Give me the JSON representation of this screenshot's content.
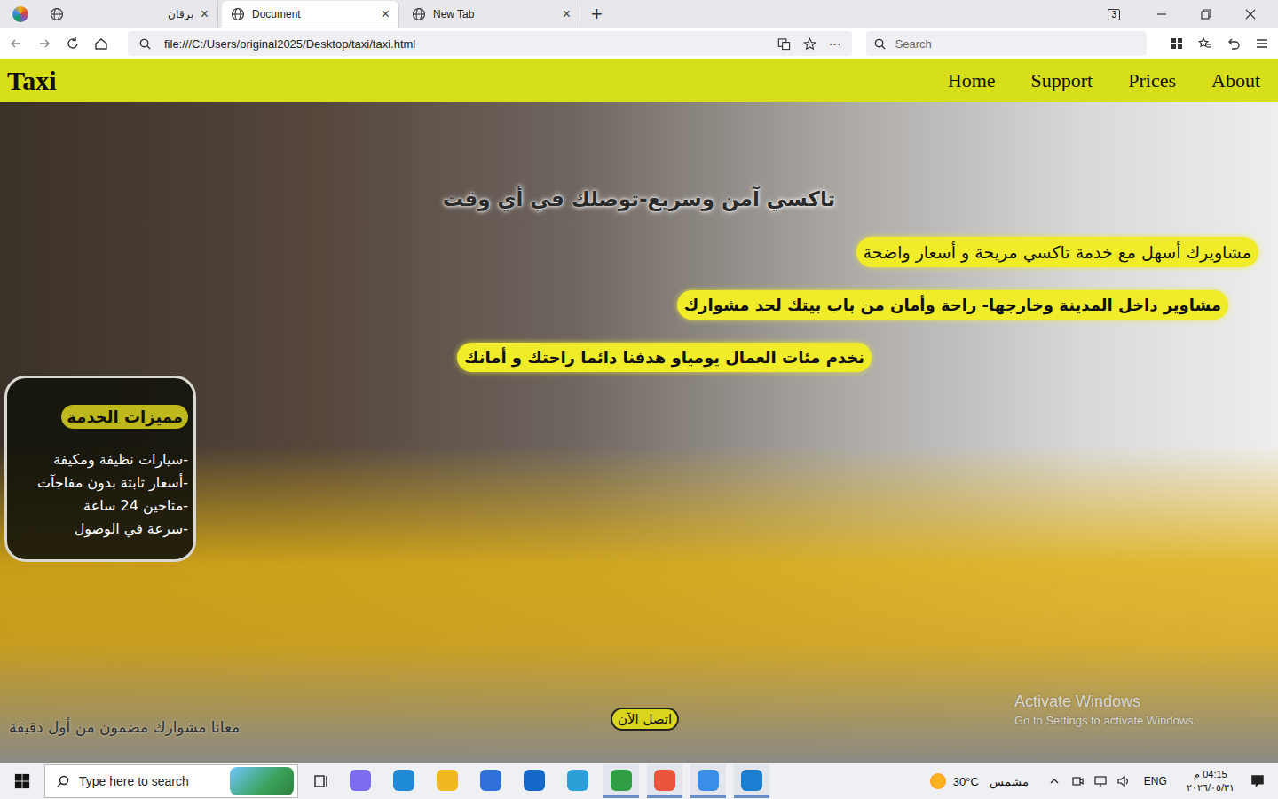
{
  "browser": {
    "tab_count": "3",
    "tabs": [
      {
        "label": "برقان",
        "selected": false,
        "close": "×"
      },
      {
        "label": "Document",
        "selected": true,
        "close": "×"
      },
      {
        "label": "New Tab",
        "selected": false,
        "close": "×"
      }
    ],
    "new_tab": "+",
    "url": "file:///C:/Users/original2025/Desktop/taxi/taxi.html",
    "more": "···",
    "search_placeholder": "Search"
  },
  "page": {
    "logo": "Taxi",
    "nav": [
      "Home",
      "Support",
      "Prices",
      "About"
    ],
    "headline": "تاكسي آمن وسريع-توصلك في أي وقت",
    "pills": [
      "مشاويرك أسهل مع خدمة تاكسي مريحة و أسعار واضحة",
      "مشاوير داخل المدينة وخارجها- راحة وأمان من باب بيتك لحد مشوارك",
      "نخدم مئات العمال يومياو هدفنا دائما راحتك و أمانك"
    ],
    "features": {
      "title": "مميزات الخدمة",
      "items": [
        "-سيارات نظيفة ومكيفة",
        "-أسعار ثابتة بدون مفاجآت",
        "-متاحين 24 ساعة",
        "-سرعة في الوصول"
      ]
    },
    "footer": "معانا مشوارك مضمون من أول دقيقة",
    "call_button": "اتصل الآن"
  },
  "watermark": {
    "title": "Activate Windows",
    "subtitle": "Go to Settings to activate Windows."
  },
  "taskbar": {
    "search_placeholder": "Type here to search",
    "apps": [
      {
        "active": false,
        "color": "#7b6cf0"
      },
      {
        "active": false,
        "color": "#1f8ad8"
      },
      {
        "active": false,
        "color": "#f0b820"
      },
      {
        "active": false,
        "color": "#2f6fd8"
      },
      {
        "active": false,
        "color": "#1668c8"
      },
      {
        "active": false,
        "color": "#2ba0d8"
      },
      {
        "active": true,
        "color": "#2f9e44"
      },
      {
        "active": true,
        "color": "#e8553a"
      },
      {
        "active": true,
        "color": "#3b8ee8"
      },
      {
        "active": true,
        "color": "#1a7fd0"
      }
    ],
    "weather": {
      "temp": "30°C",
      "condition": "مشمس"
    },
    "language": "ENG",
    "time": "04:15 م",
    "date": "٢٠٢٦/٠٥/٣١"
  }
}
